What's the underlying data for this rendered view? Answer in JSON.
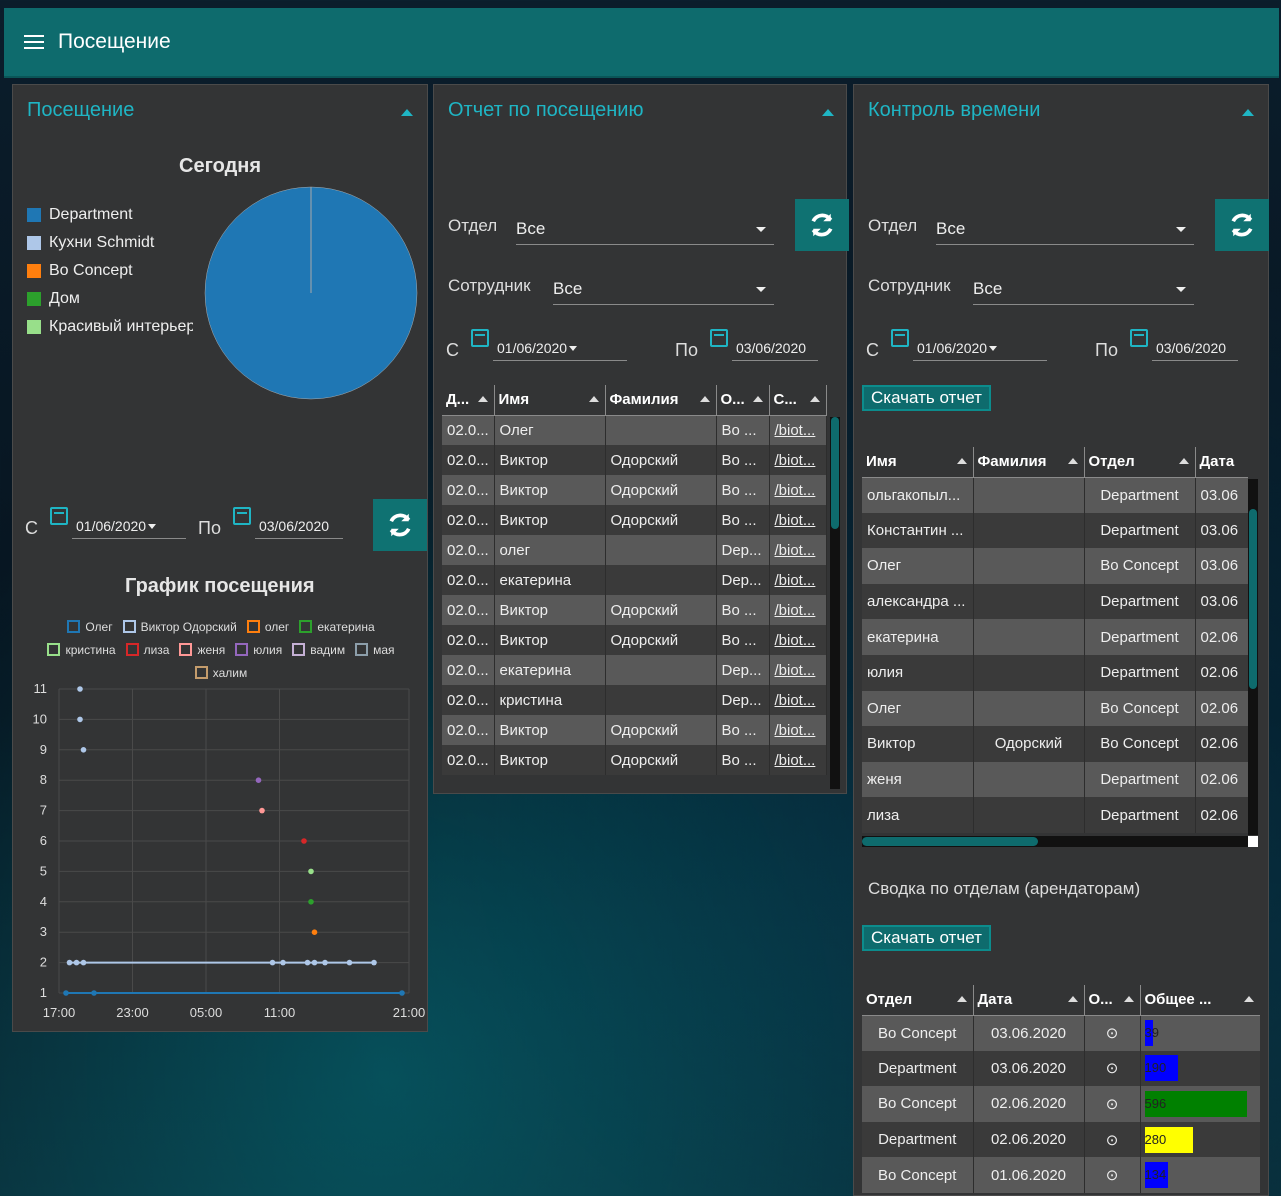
{
  "header": {
    "title": "Посещение"
  },
  "attendance": {
    "title": "Посещение",
    "pie_title": "Сегодня",
    "pie_legend": [
      {
        "label": "Department",
        "color": "#1f77b4"
      },
      {
        "label": "Кухни Schmidt",
        "color": "#aec7e8"
      },
      {
        "label": "Bo Concept",
        "color": "#ff7f0e"
      },
      {
        "label": "Дом",
        "color": "#2ca02c"
      },
      {
        "label": "Красивый интерьер",
        "color": "#98df8a"
      }
    ],
    "from_label": "С",
    "to_label": "По",
    "date_from": "01/06/2020",
    "date_to": "03/06/2020",
    "chart_title": "График посещения"
  },
  "chart_data": {
    "type": "scatter",
    "title": "График посещения",
    "ylim": [
      1,
      11
    ],
    "yticks": [
      "1",
      "2",
      "3",
      "4",
      "5",
      "6",
      "7",
      "8",
      "9",
      "10",
      "11"
    ],
    "xticks": [
      "17:00",
      "23:00",
      "05:00",
      "11:00",
      "21:00"
    ],
    "grid": true,
    "legend_position": "top",
    "series": [
      {
        "name": "Олег",
        "color": "#1f77b4",
        "points": [
          [
            0.02,
            1
          ],
          [
            0.1,
            1
          ],
          [
            0.98,
            1
          ]
        ]
      },
      {
        "name": "Виктор Одорский",
        "color": "#aec7e8",
        "points": [
          [
            0.03,
            2
          ],
          [
            0.05,
            2
          ],
          [
            0.07,
            2
          ],
          [
            0.61,
            2
          ],
          [
            0.64,
            2
          ],
          [
            0.71,
            2
          ],
          [
            0.73,
            2
          ],
          [
            0.76,
            2
          ],
          [
            0.83,
            2
          ],
          [
            0.9,
            2
          ],
          [
            0.06,
            11
          ],
          [
            0.06,
            10
          ],
          [
            0.07,
            9
          ]
        ]
      },
      {
        "name": "олег",
        "color": "#ff7f0e",
        "points": [
          [
            0.73,
            3
          ]
        ]
      },
      {
        "name": "екатерина",
        "color": "#2ca02c",
        "points": [
          [
            0.72,
            4
          ]
        ]
      },
      {
        "name": "кристина",
        "color": "#98df8a",
        "points": [
          [
            0.72,
            5
          ]
        ]
      },
      {
        "name": "лиза",
        "color": "#d62728",
        "points": [
          [
            0.7,
            6
          ]
        ]
      },
      {
        "name": "женя",
        "color": "#ff9896",
        "points": [
          [
            0.58,
            7
          ]
        ]
      },
      {
        "name": "юлия",
        "color": "#9467bd",
        "points": [
          [
            0.57,
            8
          ]
        ]
      },
      {
        "name": "вадим",
        "color": "#c5b0d5",
        "points": []
      },
      {
        "name": "мая",
        "color": "#8c9eaa",
        "points": []
      },
      {
        "name": "халим",
        "color": "#c49c6c",
        "points": []
      }
    ]
  },
  "report": {
    "title": "Отчет по посещению",
    "dept_label": "Отдел",
    "dept_value": "Все",
    "emp_label": "Сотрудник",
    "emp_value": "Все",
    "from_label": "С",
    "to_label": "По",
    "date_from": "01/06/2020",
    "date_to": "03/06/2020",
    "columns": [
      "Д...",
      "Имя",
      "Фамилия",
      "О...",
      "С..."
    ],
    "rows": [
      [
        "02.0...",
        "Олег",
        "",
        "Bo ...",
        "/biot..."
      ],
      [
        "02.0...",
        "Виктор",
        "Одорский",
        "Bo ...",
        "/biot..."
      ],
      [
        "02.0...",
        "Виктор",
        "Одорский",
        "Bo ...",
        "/biot..."
      ],
      [
        "02.0...",
        "Виктор",
        "Одорский",
        "Bo ...",
        "/biot..."
      ],
      [
        "02.0...",
        "олег",
        "",
        "Dep...",
        "/biot..."
      ],
      [
        "02.0...",
        "екатерина",
        "",
        "Dep...",
        "/biot..."
      ],
      [
        "02.0...",
        "Виктор",
        "Одорский",
        "Bo ...",
        "/biot..."
      ],
      [
        "02.0...",
        "Виктор",
        "Одорский",
        "Bo ...",
        "/biot..."
      ],
      [
        "02.0...",
        "екатерина",
        "",
        "Dep...",
        "/biot..."
      ],
      [
        "02.0...",
        "кристина",
        "",
        "Dep...",
        "/biot..."
      ],
      [
        "02.0...",
        "Виктор",
        "Одорский",
        "Bo ...",
        "/biot..."
      ],
      [
        "02.0...",
        "Виктор",
        "Одорский",
        "Bo ...",
        "/biot..."
      ]
    ]
  },
  "timecontrol": {
    "title": "Контроль времени",
    "dept_label": "Отдел",
    "dept_value": "Все",
    "emp_label": "Сотрудник",
    "emp_value": "Все",
    "from_label": "С",
    "to_label": "По",
    "date_from": "01/06/2020",
    "date_to": "03/06/2020",
    "download_label": "Скачать отчет",
    "columns": [
      "Имя",
      "Фамилия",
      "Отдел",
      "Дата"
    ],
    "rows": [
      [
        "ольгакопыл...",
        "",
        "Department",
        "03.06"
      ],
      [
        "Константин ...",
        "",
        "Department",
        "03.06"
      ],
      [
        "Олег",
        "",
        "Bo Concept",
        "03.06"
      ],
      [
        "александра ...",
        "",
        "Department",
        "03.06"
      ],
      [
        "екатерина",
        "",
        "Department",
        "02.06"
      ],
      [
        "юлия",
        "",
        "Department",
        "02.06"
      ],
      [
        "Олег",
        "",
        "Bo Concept",
        "02.06"
      ],
      [
        "Виктор",
        "Одорский",
        "Bo Concept",
        "02.06"
      ],
      [
        "женя",
        "",
        "Department",
        "02.06"
      ],
      [
        "лиза",
        "",
        "Department",
        "02.06"
      ]
    ],
    "summary_title": "Сводка по отделам (арендаторам)",
    "summary_download_label": "Скачать отчет",
    "summary_columns": [
      "Отдел",
      "Дата",
      "О...",
      "Общее ..."
    ],
    "summary_rows": [
      {
        "dept": "Bo Concept",
        "date": "03.06.2020",
        "total": "39",
        "fill": 0.08,
        "color": "#0000ff"
      },
      {
        "dept": "Department",
        "date": "03.06.2020",
        "total": "190",
        "fill": 0.3,
        "color": "#0000ff"
      },
      {
        "dept": "Bo Concept",
        "date": "02.06.2020",
        "total": "596",
        "fill": 0.92,
        "color": "#008000"
      },
      {
        "dept": "Department",
        "date": "02.06.2020",
        "total": "280",
        "fill": 0.44,
        "color": "#ffff00"
      },
      {
        "dept": "Bo Concept",
        "date": "01.06.2020",
        "total": "134",
        "fill": 0.21,
        "color": "#0000ff"
      }
    ]
  }
}
